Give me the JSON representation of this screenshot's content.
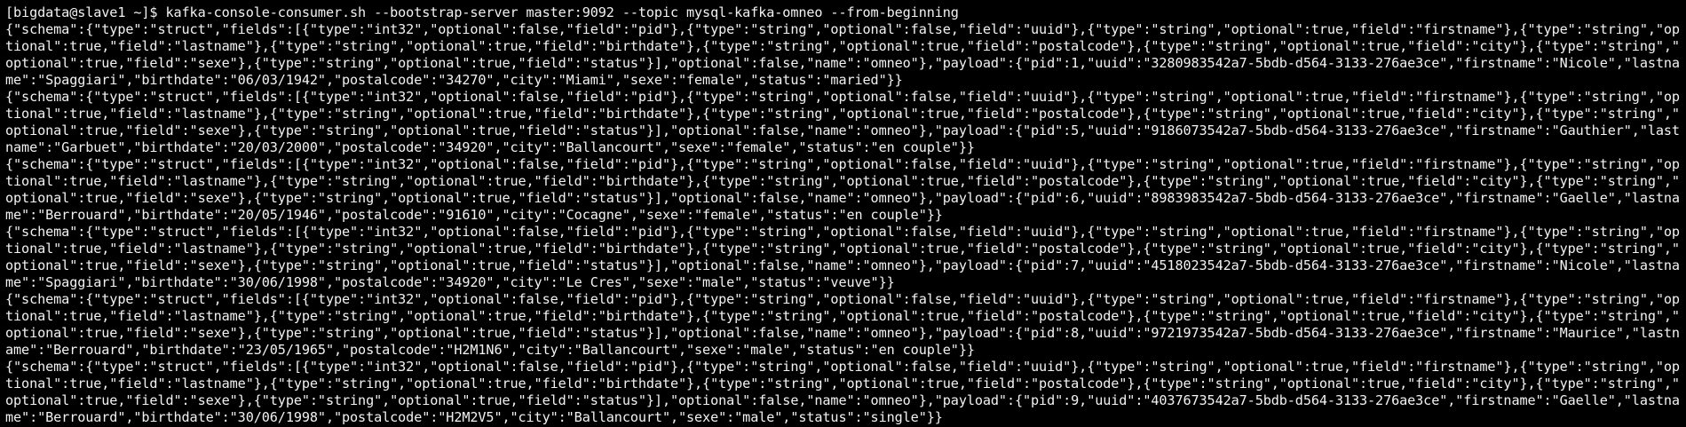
{
  "terminal": {
    "lines": [
      "[bigdata@slave1 ~]$ kafka-console-consumer.sh --bootstrap-server master:9092 --topic mysql-kafka-omneo --from-beginning",
      "{\"schema\":{\"type\":\"struct\",\"fields\":[{\"type\":\"int32\",\"optional\":false,\"field\":\"pid\"},{\"type\":\"string\",\"optional\":false,\"field\":\"uuid\"},{\"type\":\"string\",\"optional\":true,\"field\":\"firstname\"},{\"type\":\"string\",\"op",
      "tional\":true,\"field\":\"lastname\"},{\"type\":\"string\",\"optional\":true,\"field\":\"birthdate\"},{\"type\":\"string\",\"optional\":true,\"field\":\"postalcode\"},{\"type\":\"string\",\"optional\":true,\"field\":\"city\"},{\"type\":\"string\",\"",
      "optional\":true,\"field\":\"sexe\"},{\"type\":\"string\",\"optional\":true,\"field\":\"status\"}],\"optional\":false,\"name\":\"omneo\"},\"payload\":{\"pid\":1,\"uuid\":\"3280983542a7-5bdb-d564-3133-276ae3ce\",\"firstname\":\"Nicole\",\"lastna",
      "me\":\"Spaggiari\",\"birthdate\":\"06/03/1942\",\"postalcode\":\"34270\",\"city\":\"Miami\",\"sexe\":\"female\",\"status\":\"maried\"}}",
      "{\"schema\":{\"type\":\"struct\",\"fields\":[{\"type\":\"int32\",\"optional\":false,\"field\":\"pid\"},{\"type\":\"string\",\"optional\":false,\"field\":\"uuid\"},{\"type\":\"string\",\"optional\":true,\"field\":\"firstname\"},{\"type\":\"string\",\"op",
      "tional\":true,\"field\":\"lastname\"},{\"type\":\"string\",\"optional\":true,\"field\":\"birthdate\"},{\"type\":\"string\",\"optional\":true,\"field\":\"postalcode\"},{\"type\":\"string\",\"optional\":true,\"field\":\"city\"},{\"type\":\"string\",\"",
      "optional\":true,\"field\":\"sexe\"},{\"type\":\"string\",\"optional\":true,\"field\":\"status\"}],\"optional\":false,\"name\":\"omneo\"},\"payload\":{\"pid\":5,\"uuid\":\"9186073542a7-5bdb-d564-3133-276ae3ce\",\"firstname\":\"Gauthier\",\"last",
      "name\":\"Garbuet\",\"birthdate\":\"20/03/2000\",\"postalcode\":\"34920\",\"city\":\"Ballancourt\",\"sexe\":\"female\",\"status\":\"en couple\"}}",
      "{\"schema\":{\"type\":\"struct\",\"fields\":[{\"type\":\"int32\",\"optional\":false,\"field\":\"pid\"},{\"type\":\"string\",\"optional\":false,\"field\":\"uuid\"},{\"type\":\"string\",\"optional\":true,\"field\":\"firstname\"},{\"type\":\"string\",\"op",
      "tional\":true,\"field\":\"lastname\"},{\"type\":\"string\",\"optional\":true,\"field\":\"birthdate\"},{\"type\":\"string\",\"optional\":true,\"field\":\"postalcode\"},{\"type\":\"string\",\"optional\":true,\"field\":\"city\"},{\"type\":\"string\",\"",
      "optional\":true,\"field\":\"sexe\"},{\"type\":\"string\",\"optional\":true,\"field\":\"status\"}],\"optional\":false,\"name\":\"omneo\"},\"payload\":{\"pid\":6,\"uuid\":\"8983983542a7-5bdb-d564-3133-276ae3ce\",\"firstname\":\"Gaelle\",\"lastna",
      "me\":\"Berrouard\",\"birthdate\":\"20/05/1946\",\"postalcode\":\"91610\",\"city\":\"Cocagne\",\"sexe\":\"female\",\"status\":\"en couple\"}}",
      "{\"schema\":{\"type\":\"struct\",\"fields\":[{\"type\":\"int32\",\"optional\":false,\"field\":\"pid\"},{\"type\":\"string\",\"optional\":false,\"field\":\"uuid\"},{\"type\":\"string\",\"optional\":true,\"field\":\"firstname\"},{\"type\":\"string\",\"op",
      "tional\":true,\"field\":\"lastname\"},{\"type\":\"string\",\"optional\":true,\"field\":\"birthdate\"},{\"type\":\"string\",\"optional\":true,\"field\":\"postalcode\"},{\"type\":\"string\",\"optional\":true,\"field\":\"city\"},{\"type\":\"string\",\"",
      "optional\":true,\"field\":\"sexe\"},{\"type\":\"string\",\"optional\":true,\"field\":\"status\"}],\"optional\":false,\"name\":\"omneo\"},\"payload\":{\"pid\":7,\"uuid\":\"4518023542a7-5bdb-d564-3133-276ae3ce\",\"firstname\":\"Nicole\",\"lastna",
      "me\":\"Spaggiari\",\"birthdate\":\"30/06/1998\",\"postalcode\":\"34920\",\"city\":\"Le Cres\",\"sexe\":\"male\",\"status\":\"veuve\"}}",
      "{\"schema\":{\"type\":\"struct\",\"fields\":[{\"type\":\"int32\",\"optional\":false,\"field\":\"pid\"},{\"type\":\"string\",\"optional\":false,\"field\":\"uuid\"},{\"type\":\"string\",\"optional\":true,\"field\":\"firstname\"},{\"type\":\"string\",\"op",
      "tional\":true,\"field\":\"lastname\"},{\"type\":\"string\",\"optional\":true,\"field\":\"birthdate\"},{\"type\":\"string\",\"optional\":true,\"field\":\"postalcode\"},{\"type\":\"string\",\"optional\":true,\"field\":\"city\"},{\"type\":\"string\",\"",
      "optional\":true,\"field\":\"sexe\"},{\"type\":\"string\",\"optional\":true,\"field\":\"status\"}],\"optional\":false,\"name\":\"omneo\"},\"payload\":{\"pid\":8,\"uuid\":\"9721973542a7-5bdb-d564-3133-276ae3ce\",\"firstname\":\"Maurice\",\"lastn",
      "ame\":\"Berrouard\",\"birthdate\":\"23/05/1965\",\"postalcode\":\"H2M1N6\",\"city\":\"Ballancourt\",\"sexe\":\"male\",\"status\":\"en couple\"}}",
      "{\"schema\":{\"type\":\"struct\",\"fields\":[{\"type\":\"int32\",\"optional\":false,\"field\":\"pid\"},{\"type\":\"string\",\"optional\":false,\"field\":\"uuid\"},{\"type\":\"string\",\"optional\":true,\"field\":\"firstname\"},{\"type\":\"string\",\"op",
      "tional\":true,\"field\":\"lastname\"},{\"type\":\"string\",\"optional\":true,\"field\":\"birthdate\"},{\"type\":\"string\",\"optional\":true,\"field\":\"postalcode\"},{\"type\":\"string\",\"optional\":true,\"field\":\"city\"},{\"type\":\"string\",\"",
      "optional\":true,\"field\":\"sexe\"},{\"type\":\"string\",\"optional\":true,\"field\":\"status\"}],\"optional\":false,\"name\":\"omneo\"},\"payload\":{\"pid\":9,\"uuid\":\"4037673542a7-5bdb-d564-3133-276ae3ce\",\"firstname\":\"Gaelle\",\"lastna",
      "me\":\"Berrouard\",\"birthdate\":\"30/06/1998\",\"postalcode\":\"H2M2V5\",\"city\":\"Ballancourt\",\"sexe\":\"male\",\"status\":\"single\"}}"
    ]
  },
  "colors": {
    "background": "#000000",
    "foreground": "#f2f2f2"
  }
}
